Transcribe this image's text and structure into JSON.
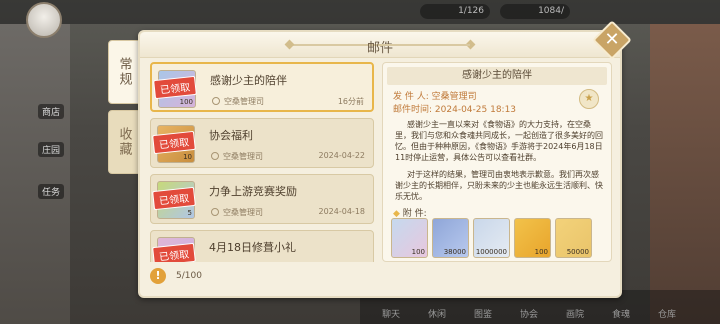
{
  "panel": {
    "title": "邮件",
    "close_icon": "✕"
  },
  "tabs": [
    {
      "label": "常规",
      "active": true
    },
    {
      "label": "收藏",
      "active": false
    }
  ],
  "mails": [
    {
      "title": "感谢少主的陪伴",
      "sender": "空桑管理司",
      "time": "16分前",
      "badge": "已领取",
      "count": "100",
      "selected": true
    },
    {
      "title": "协会福利",
      "sender": "空桑管理司",
      "time": "2024-04-22",
      "badge": "已领取",
      "count": "10"
    },
    {
      "title": "力争上游竞赛奖励",
      "sender": "空桑管理司",
      "time": "2024-04-18",
      "badge": "已领取",
      "count": "5"
    },
    {
      "title": "4月18日修葺小礼",
      "sender": "",
      "time": "",
      "badge": "已领取",
      "count": ""
    }
  ],
  "detail": {
    "title": "感谢少主的陪伴",
    "sender_label": "发  件  人:",
    "sender": "空桑管理司",
    "time_label": "邮件时间:",
    "time": "2024-04-25  18:13",
    "body1": "感谢少主一直以来对《食物语》的大力支持，在空桑里，我们与您和众食魂共同成长，一起创造了很多美好的回忆。但由于种种原因，《食物语》手游将于2024年6月18日11时停止运营，具体公告可以查看社群。",
    "body2": "对于这样的结果，管理司由衷地表示歉意。我们再次感谢少主的长期相伴，只盼未来的少主也能永远生活顺利、快乐无忧。",
    "attach_label": "附      件:",
    "attachments": [
      {
        "name": "item-1",
        "count": "100"
      },
      {
        "name": "item-2",
        "count": "38000"
      },
      {
        "name": "item-3",
        "count": "1000000"
      },
      {
        "name": "item-4",
        "count": "100"
      },
      {
        "name": "item-5",
        "count": "50000"
      }
    ]
  },
  "footer": {
    "warn_icon": "!",
    "count": "5/100"
  },
  "background": {
    "bottom_labels": [
      "聊天",
      "休闲",
      "图鉴",
      "协会",
      "画院",
      "食魂",
      "仓库"
    ],
    "left_labels": [
      "商店",
      "庄园",
      "任务"
    ],
    "top_res": [
      "1/126",
      "1084/"
    ]
  }
}
